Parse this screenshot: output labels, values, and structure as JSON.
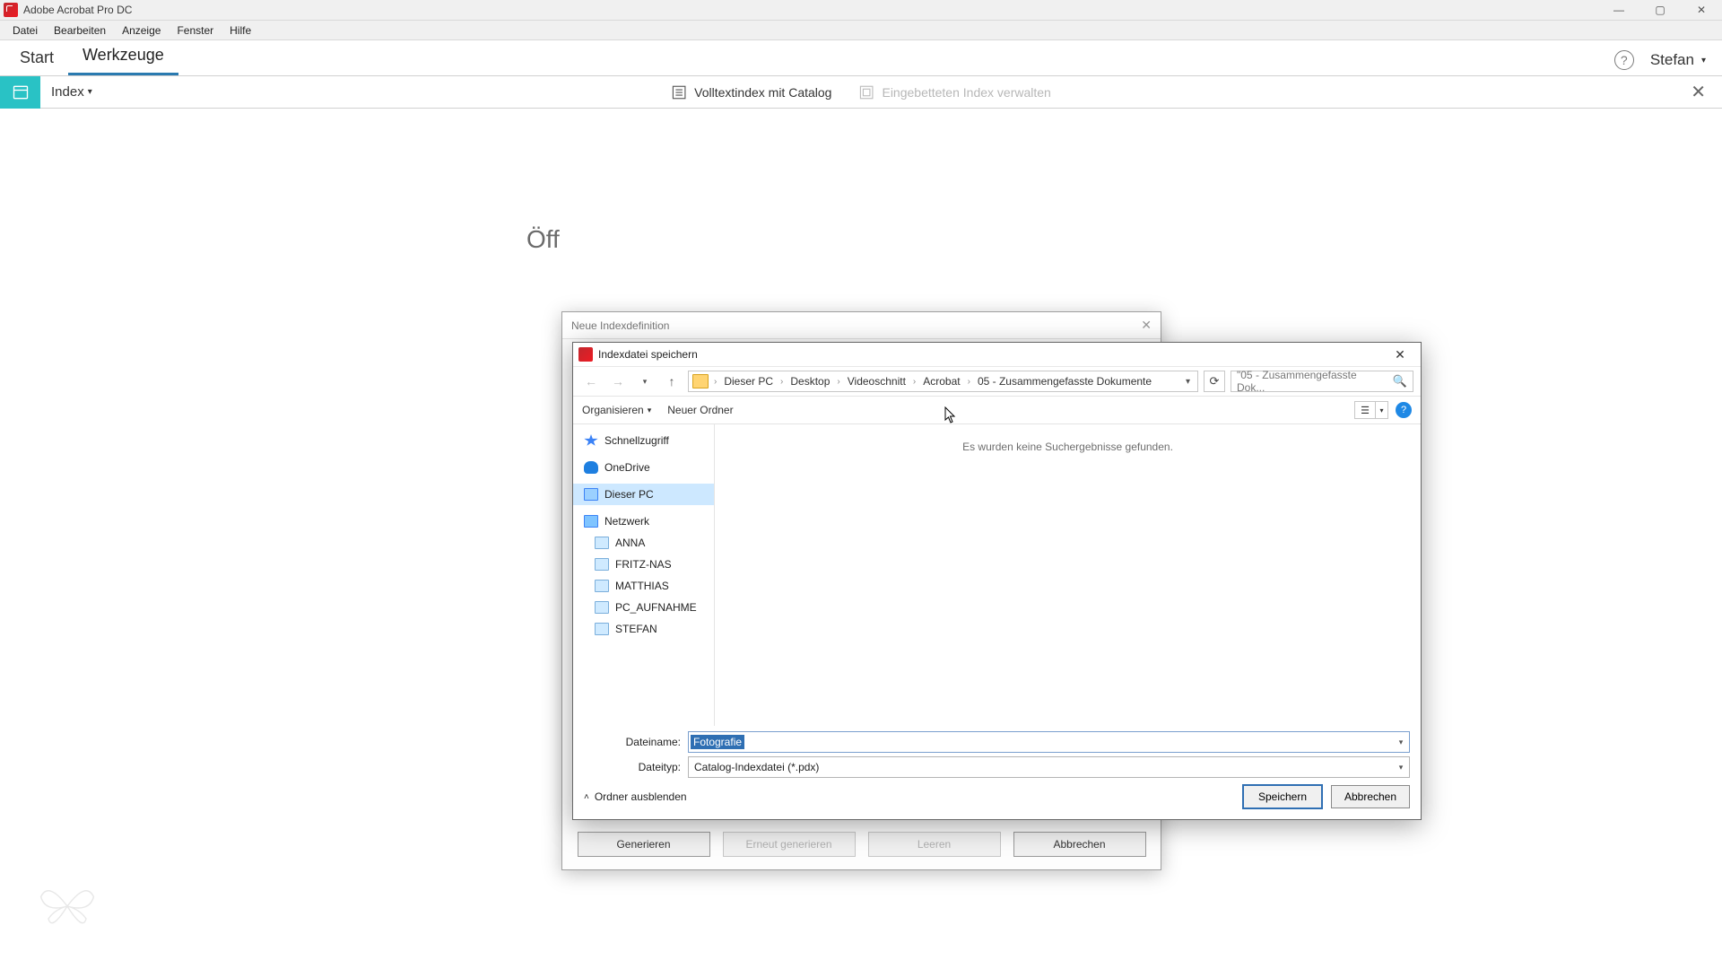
{
  "app": {
    "title": "Adobe Acrobat Pro DC"
  },
  "menubar": {
    "items": [
      "Datei",
      "Bearbeiten",
      "Anzeige",
      "Fenster",
      "Hilfe"
    ]
  },
  "tabs": {
    "start": "Start",
    "tools": "Werkzeuge"
  },
  "user": {
    "name": "Stefan"
  },
  "toolbar": {
    "index_label": "Index",
    "fulltext": "Volltextindex mit Catalog",
    "embedded": "Eingebetteten Index verwalten"
  },
  "background_text": "Öff",
  "index_dialog": {
    "title": "Neue Indexdefinition",
    "buttons": {
      "generate": "Generieren",
      "regenerate": "Erneut generieren",
      "clear": "Leeren",
      "cancel": "Abbrechen"
    }
  },
  "save_dialog": {
    "title": "Indexdatei speichern",
    "breadcrumb": [
      "Dieser PC",
      "Desktop",
      "Videoschnitt",
      "Acrobat",
      "05 - Zusammengefasste Dokumente"
    ],
    "search_placeholder": "\"05 - Zusammengefasste Dok...",
    "organize": "Organisieren",
    "new_folder": "Neuer Ordner",
    "navpane": {
      "quickaccess": "Schnellzugriff",
      "onedrive": "OneDrive",
      "thispc": "Dieser PC",
      "network": "Netzwerk",
      "hosts": [
        "ANNA",
        "FRITZ-NAS",
        "MATTHIAS",
        "PC_AUFNAHME",
        "STEFAN"
      ]
    },
    "no_results": "Es wurden keine Suchergebnisse gefunden.",
    "filename_label": "Dateiname:",
    "filename_value": "Fotografie",
    "filetype_label": "Dateityp:",
    "filetype_value": "Catalog-Indexdatei (*.pdx)",
    "hide_folders": "Ordner ausblenden",
    "save": "Speichern",
    "cancel": "Abbrechen"
  }
}
